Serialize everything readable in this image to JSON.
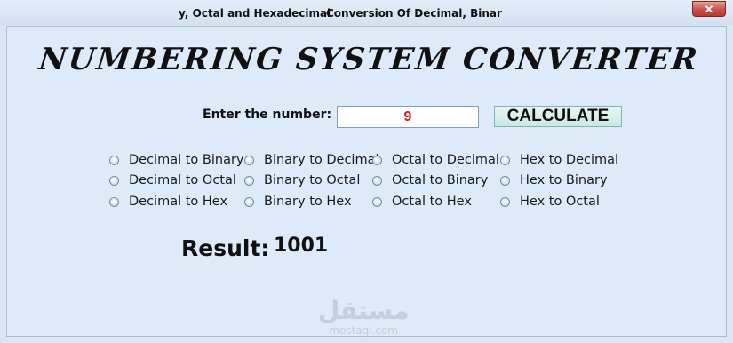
{
  "window": {
    "title_part1": "y, Octal and Hexadecimal",
    "title_part2": "Conversion Of Decimal, Binar",
    "close_label": "✕"
  },
  "header": {
    "title": "NUMBERING SYSTEM CONVERTER"
  },
  "input": {
    "label": "Enter the number:",
    "value": "9"
  },
  "calculate_button": {
    "label": "CALCULATE"
  },
  "options": {
    "dec_bin": "Decimal to Binary",
    "dec_oct": "Decimal to Octal",
    "dec_hex": "Decimal to Hex",
    "bin_dec": "Binary to Decimal",
    "bin_oct": "Binary to Octal",
    "bin_hex": "Binary to Hex",
    "oct_dec": "Octal to Decimal",
    "oct_bin": "Octal to Binary",
    "oct_hex": "Octal to Hex",
    "hex_dec": "Hex to Decimal",
    "hex_bin": "Hex to Binary",
    "hex_oct": "Hex to Octal"
  },
  "result": {
    "label": "Result:",
    "value": "1001"
  },
  "watermark": {
    "logo": "مستقل",
    "url": "mostaql.com"
  },
  "colors": {
    "input_text": "#d01a1a",
    "client_background": "#dceaf9",
    "button_background": "#c9e8e4"
  }
}
